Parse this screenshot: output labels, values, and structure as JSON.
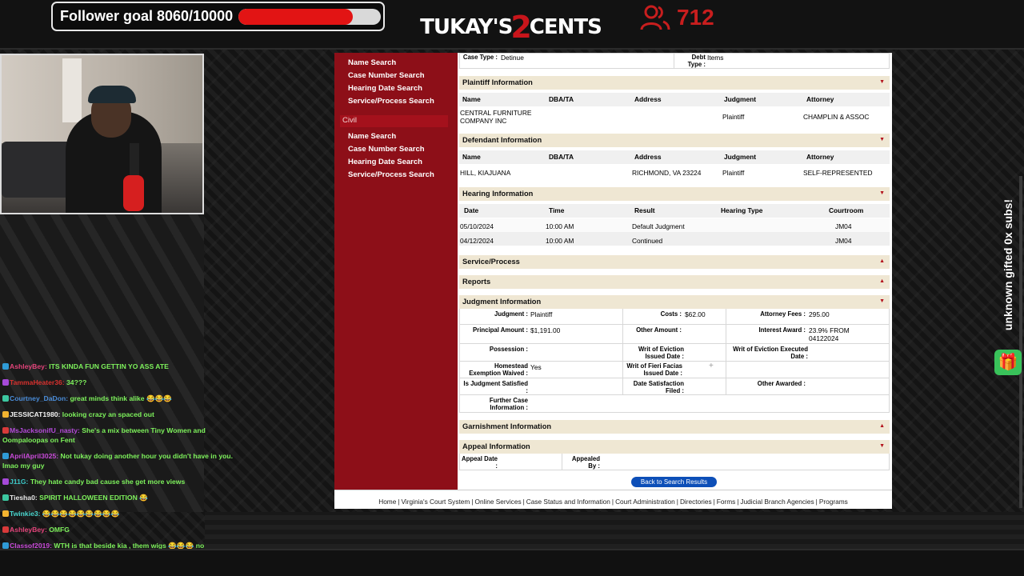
{
  "stream": {
    "follower_goal": "Follower goal 8060/10000",
    "goal_progress": 0.806,
    "logo_left": "TUKAY'S",
    "logo_num": "2",
    "logo_right": "CENTS",
    "viewer_count": "712",
    "subs_text": "unknown gifted 0x subs!",
    "accent_red": "#e21414"
  },
  "chat": [
    {
      "user": "AshleyBey:",
      "user_color": "#e2447a",
      "msg": "ITS KINDA FUN GETTIN YO ASS ATE",
      "msg_color": "#7ef25c"
    },
    {
      "user": "TammaHeater36:",
      "user_color": "#d8312e",
      "msg": "34???",
      "msg_color": "#7ef25c"
    },
    {
      "user": "Courtney_DaDon:",
      "user_color": "#4a8cd8",
      "msg": "great minds think alike 😂😂😂",
      "msg_color": "#7ef25c"
    },
    {
      "user": "JESSICAT1980:",
      "user_color": "#f3f3f3",
      "msg": "looking crazy an spaced out",
      "msg_color": "#7ef25c"
    },
    {
      "user": "MsJacksonifU_nasty:",
      "user_color": "#b34ad8",
      "msg": "She's a mix between Tiny Women and Oompaloopas on Fent",
      "msg_color": "#7ef25c"
    },
    {
      "user": "AprilApril3025:",
      "user_color": "#c84ad8",
      "msg": "Not tukay doing another hour you didn't have in you. lmao my guy",
      "msg_color": "#7ef25c"
    },
    {
      "user": "J11G:",
      "user_color": "#3cc7c7",
      "msg": "They hate candy bad cause she get more views",
      "msg_color": "#7ef25c"
    },
    {
      "user": "Tiesha0:",
      "user_color": "#e6e6e6",
      "msg": "SPIRIT HALLOWEEN EDITION 😂",
      "msg_color": "#7ef25c"
    },
    {
      "user": "Twinkie3:",
      "user_color": "#4ad8d0",
      "msg": "😂😂😂😂😂😂😂😂😂",
      "msg_color": "#7ef25c"
    },
    {
      "user": "AshleyBey:",
      "user_color": "#e2447a",
      "msg": "OMFG",
      "msg_color": "#7ef25c"
    },
    {
      "user": "Classof2019:",
      "user_color": "#c84ad8",
      "msg": "WTH is that beside kia , them wigs 😂😂😂 no",
      "msg_color": "#7ef25c"
    }
  ],
  "nav": {
    "top_links": [
      "Name Search",
      "Case Number Search",
      "Hearing Date Search",
      "Service/Process Search"
    ],
    "civil_label": "Civil",
    "civil_links": [
      "Name Search",
      "Case Number Search",
      "Hearing Date Search",
      "Service/Process Search"
    ]
  },
  "case": {
    "case_type_label": "Case Type :",
    "case_type_value": "Detinue",
    "debt_type_label": "Debt Type :",
    "debt_type_value": "Items"
  },
  "plaintiff": {
    "title": "Plaintiff Information",
    "headers": [
      "Name",
      "DBA/TA",
      "Address",
      "Judgment",
      "Attorney"
    ],
    "row": {
      "name": "CENTRAL FURNITURE COMPANY INC",
      "dba": "",
      "address": "",
      "judgment": "Plaintiff",
      "attorney": "CHAMPLIN & ASSOC"
    }
  },
  "defendant": {
    "title": "Defendant Information",
    "headers": [
      "Name",
      "DBA/TA",
      "Address",
      "Judgment",
      "Attorney"
    ],
    "row": {
      "name": "HILL, KIAJUANA",
      "dba": "",
      "address": "RICHMOND, VA 23224",
      "judgment": "Plaintiff",
      "attorney": "SELF-REPRESENTED"
    }
  },
  "hearing": {
    "title": "Hearing Information",
    "headers": [
      "Date",
      "Time",
      "Result",
      "Hearing Type",
      "Courtroom"
    ],
    "rows": [
      {
        "date": "05/10/2024",
        "time": "10:00 AM",
        "result": "Default Judgment",
        "type": "",
        "courtroom": "JM04"
      },
      {
        "date": "04/12/2024",
        "time": "10:00 AM",
        "result": "Continued",
        "type": "",
        "courtroom": "JM04"
      }
    ]
  },
  "service_title": "Service/Process",
  "reports_title": "Reports",
  "judgment": {
    "title": "Judgment Information",
    "judgment_label": "Judgment :",
    "judgment_value": "Plaintiff",
    "costs_label": "Costs :",
    "costs_value": "$62.00",
    "attorney_fees_label": "Attorney Fees :",
    "attorney_fees_value": "295.00",
    "principal_label": "Principal Amount :",
    "principal_value": "$1,191.00",
    "other_amount_label": "Other Amount :",
    "other_amount_value": "",
    "interest_label": "Interest Award :",
    "interest_value": "23.9% FROM 04122024",
    "possession_label": "Possession :",
    "writ_eviction_issued_label": "Writ of Eviction Issued Date :",
    "writ_eviction_executed_label": "Writ of Eviction Executed Date :",
    "homestead_label": "Homestead Exemption Waived :",
    "homestead_value": "Yes",
    "writ_fieri_label": "Writ of Fieri Facias Issued Date :",
    "satisfied_label": "Is Judgment Satisfied :",
    "date_satisfaction_label": "Date Satisfaction Filed :",
    "other_awarded_label": "Other Awarded :",
    "further_case_label": "Further Case Information :"
  },
  "garnishment_title": "Garnishment Information",
  "appeal": {
    "title": "Appeal Information",
    "appeal_date_label": "Appeal Date :",
    "appealed_by_label": "Appealed By :"
  },
  "back_button": "Back to Search Results",
  "footer_links": [
    "Home",
    "Virginia's Court System",
    "Online Services",
    "Case Status and Information",
    "Court Administration",
    "Directories",
    "Forms",
    "Judicial Branch Agencies",
    "Programs"
  ]
}
